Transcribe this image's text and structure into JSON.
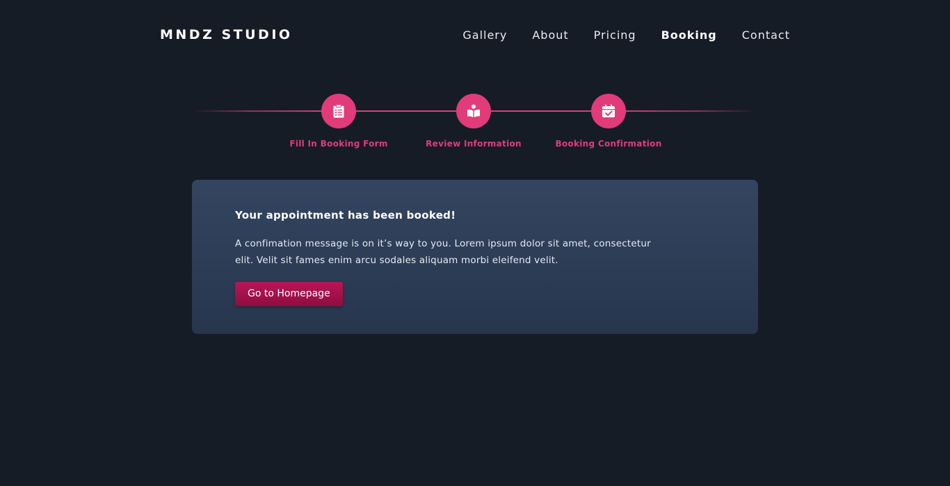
{
  "brand": {
    "name": "MNDZ STUDIO"
  },
  "nav": {
    "items": [
      {
        "label": "Gallery",
        "active": false
      },
      {
        "label": "About",
        "active": false
      },
      {
        "label": "Pricing",
        "active": false
      },
      {
        "label": "Booking",
        "active": true
      },
      {
        "label": "Contact",
        "active": false
      }
    ]
  },
  "stepper": {
    "steps": [
      {
        "label": "Fill In Booking Form",
        "icon": "clipboard-list-icon"
      },
      {
        "label": "Review Information",
        "icon": "open-book-icon"
      },
      {
        "label": "Booking Confirmation",
        "icon": "calendar-check-icon"
      }
    ],
    "accent_color": "#e23b7a"
  },
  "confirmation": {
    "title": "Your appointment has been booked!",
    "message": "A confimation message is on it’s way to you. Lorem ipsum dolor sit amet, consectetur elit. Velit sit fames enim arcu sodales aliquam morbi eleifend velit.",
    "button_label": "Go to Homepage"
  },
  "colors": {
    "background": "#161c26",
    "accent": "#e23b7a",
    "button": "#a3114b",
    "card": "#2f3f58"
  }
}
